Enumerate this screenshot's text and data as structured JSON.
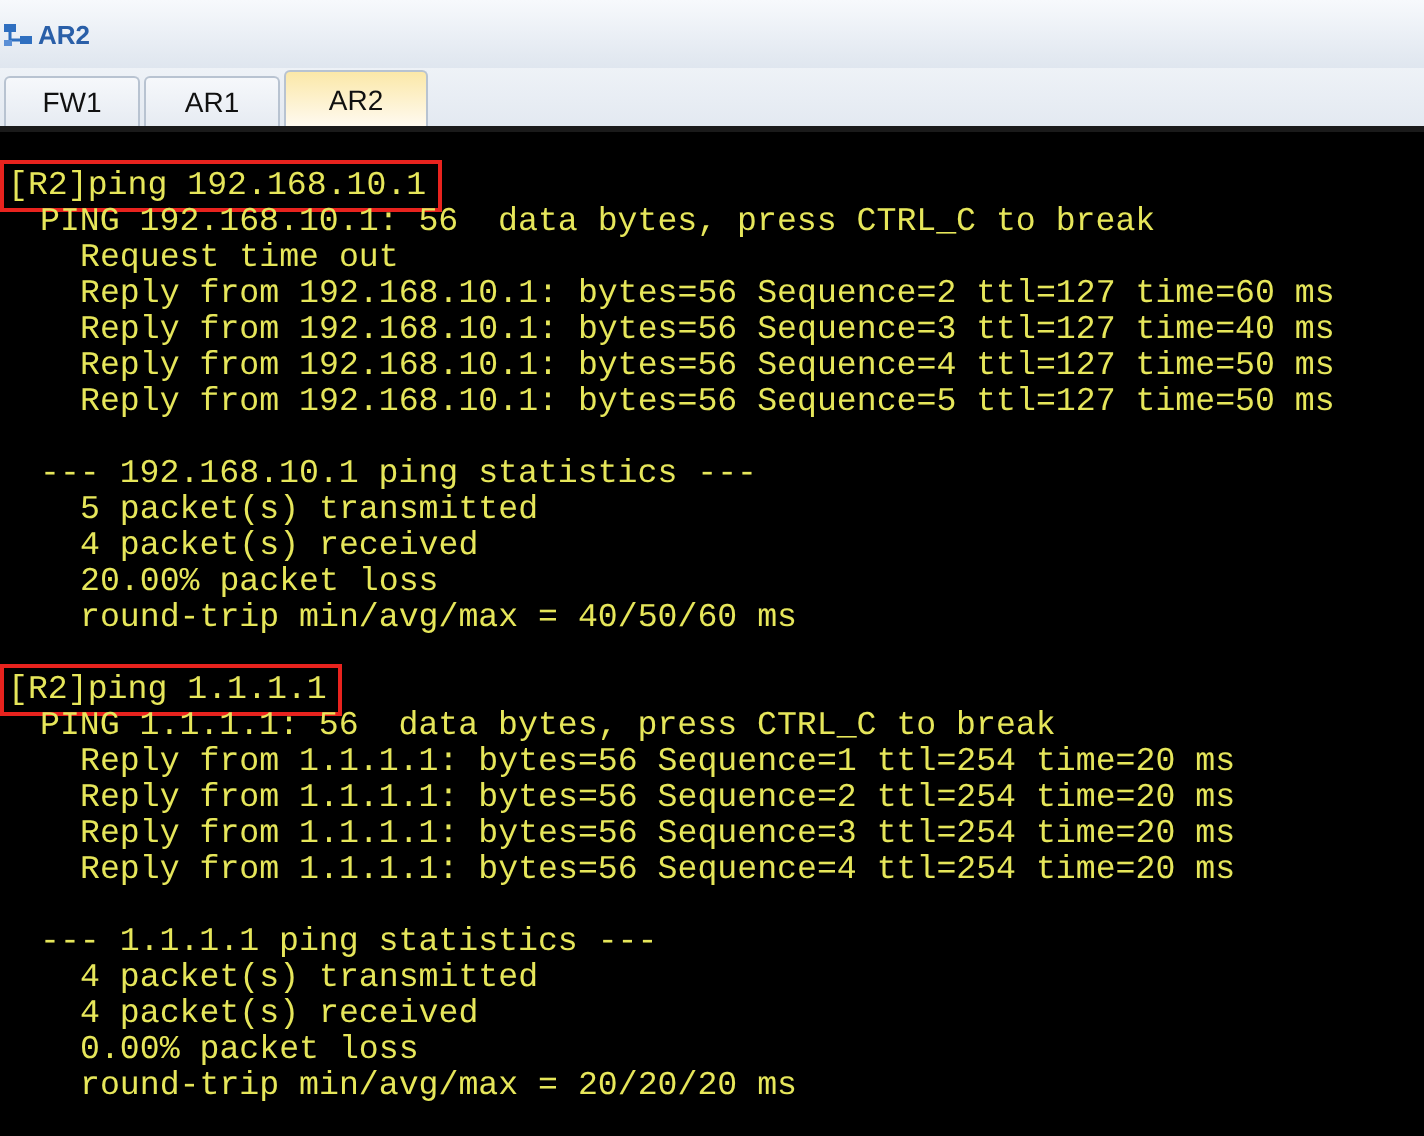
{
  "window": {
    "title": "AR2"
  },
  "tabs": [
    {
      "label": "FW1",
      "selected": false
    },
    {
      "label": "AR1",
      "selected": false
    },
    {
      "label": "AR2",
      "selected": true
    }
  ],
  "terminal": {
    "lines": [
      {
        "kind": "command",
        "text": "[R2]ping 192.168.10.1"
      },
      {
        "kind": "header",
        "text": "PING 192.168.10.1: 56  data bytes, press CTRL_C to break"
      },
      {
        "kind": "detail",
        "text": "Request time out"
      },
      {
        "kind": "detail",
        "text": "Reply from 192.168.10.1: bytes=56 Sequence=2 ttl=127 time=60 ms"
      },
      {
        "kind": "detail",
        "text": "Reply from 192.168.10.1: bytes=56 Sequence=3 ttl=127 time=40 ms"
      },
      {
        "kind": "detail",
        "text": "Reply from 192.168.10.1: bytes=56 Sequence=4 ttl=127 time=50 ms"
      },
      {
        "kind": "detail",
        "text": "Reply from 192.168.10.1: bytes=56 Sequence=5 ttl=127 time=50 ms"
      },
      {
        "kind": "blank"
      },
      {
        "kind": "header",
        "text": "--- 192.168.10.1 ping statistics ---"
      },
      {
        "kind": "detail",
        "text": "5 packet(s) transmitted"
      },
      {
        "kind": "detail",
        "text": "4 packet(s) received"
      },
      {
        "kind": "detail",
        "text": "20.00% packet loss"
      },
      {
        "kind": "detail",
        "text": "round-trip min/avg/max = 40/50/60 ms"
      },
      {
        "kind": "blank"
      },
      {
        "kind": "command",
        "text": "[R2]ping 1.1.1.1"
      },
      {
        "kind": "header",
        "text": "PING 1.1.1.1: 56  data bytes, press CTRL_C to break"
      },
      {
        "kind": "detail",
        "text": "Reply from 1.1.1.1: bytes=56 Sequence=1 ttl=254 time=20 ms"
      },
      {
        "kind": "detail",
        "text": "Reply from 1.1.1.1: bytes=56 Sequence=2 ttl=254 time=20 ms"
      },
      {
        "kind": "detail",
        "text": "Reply from 1.1.1.1: bytes=56 Sequence=3 ttl=254 time=20 ms"
      },
      {
        "kind": "detail",
        "text": "Reply from 1.1.1.1: bytes=56 Sequence=4 ttl=254 time=20 ms"
      },
      {
        "kind": "blank"
      },
      {
        "kind": "header",
        "text": "--- 1.1.1.1 ping statistics ---"
      },
      {
        "kind": "detail",
        "text": "4 packet(s) transmitted"
      },
      {
        "kind": "detail",
        "text": "4 packet(s) received"
      },
      {
        "kind": "detail",
        "text": "0.00% packet loss"
      },
      {
        "kind": "detail",
        "text": "round-trip min/avg/max = 20/20/20 ms"
      }
    ]
  }
}
